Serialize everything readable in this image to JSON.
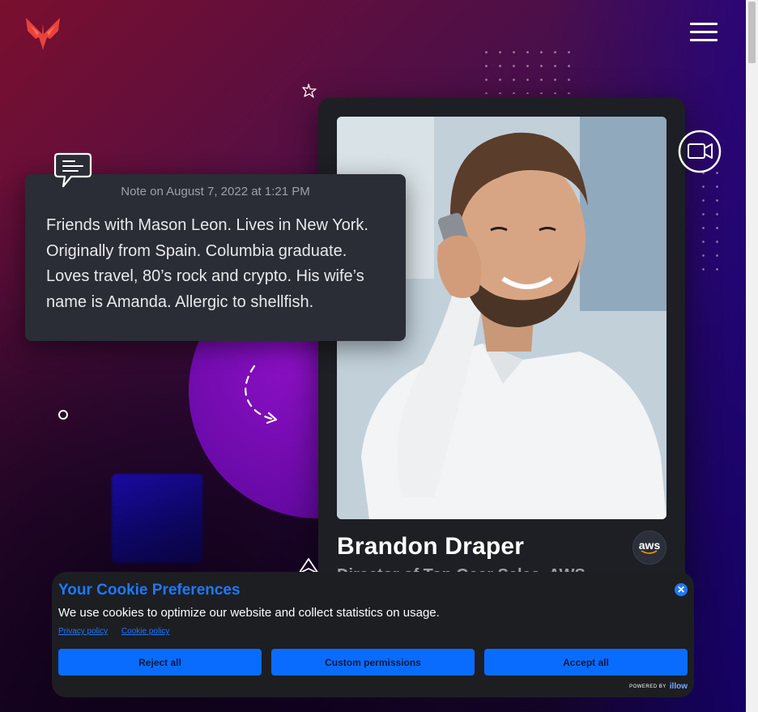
{
  "note": {
    "date": "Note on August 7, 2022 at 1:21 PM",
    "body": "Friends with Mason Leon. Lives in New York. Originally from Spain. Columbia graduate. Loves travel, 80’s rock and crypto. His wife’s name is Amanda. Allergic to shellfish."
  },
  "profile": {
    "name": "Brandon Draper",
    "subtitle": "Director of Top Gear Sales, AWS",
    "badge": "aws"
  },
  "cookie": {
    "title": "Your Cookie Preferences",
    "text": "We use cookies to optimize our website and collect statistics on usage.",
    "privacy_link": "Privacy policy",
    "cookie_link": "Cookie policy",
    "reject": "Reject all",
    "custom": "Custom permissions",
    "accept": "Accept all",
    "powered_by": "POWERED BY",
    "powered_brand": "illow",
    "close": "✕"
  },
  "colors": {
    "accent_blue": "#1e78ff",
    "button_blue": "#0a6cff",
    "brand_red": "#e8433a"
  }
}
